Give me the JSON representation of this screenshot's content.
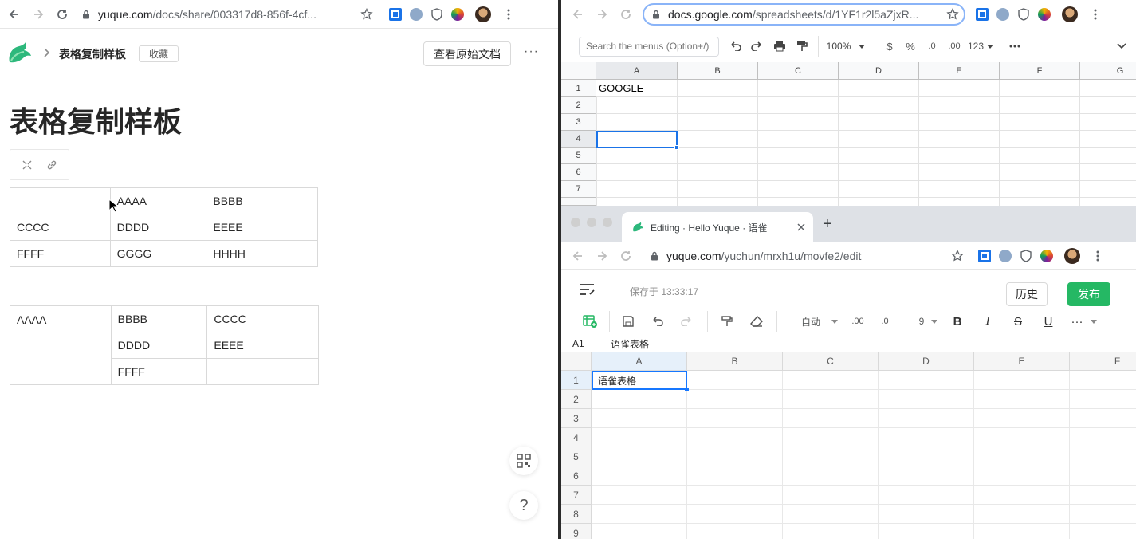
{
  "left_browser": {
    "url_host": "yuque.com",
    "url_path": "/docs/share/003317d8-856f-4cf..."
  },
  "doc": {
    "breadcrumb": "表格复制样板",
    "favorite_label": "收藏",
    "view_original_label": "查看原始文档",
    "more_label": "···",
    "title": "表格复制样板",
    "table1": [
      [
        "",
        "AAAA",
        "BBBB"
      ],
      [
        "CCCC",
        "DDDD",
        "EEEE"
      ],
      [
        "FFFF",
        "GGGG",
        "HHHH"
      ]
    ],
    "table2": {
      "merged": "AAAA",
      "rows": [
        [
          "BBBB",
          "CCCC"
        ],
        [
          "DDDD",
          "EEEE"
        ],
        [
          "FFFF",
          ""
        ]
      ]
    },
    "help_label": "?"
  },
  "gsheets": {
    "url_host": "docs.google.com",
    "url_path": "/spreadsheets/d/1YF1r2l5aZjxR...",
    "search_placeholder": "Search the menus (Option+/)",
    "zoom": "100%",
    "currency": "$",
    "percent": "%",
    "dec_less": ".0",
    "dec_more": ".00",
    "format_more": "123",
    "columns": [
      "A",
      "B",
      "C",
      "D",
      "E",
      "F",
      "G"
    ],
    "rows": [
      "1",
      "2",
      "3",
      "4",
      "5",
      "6",
      "7"
    ],
    "cell_a1": "GOOGLE"
  },
  "yuque": {
    "tab_title": "Editing · Hello Yuque · 语雀",
    "new_tab": "+",
    "url_host": "yuque.com",
    "url_path": "/yuchun/mrxh1u/movfe2/edit",
    "saved_text": "保存于 13:33:17",
    "history_label": "历史",
    "publish_label": "发布",
    "font_auto": "自动",
    "dec_more": ".00",
    "dec_less": ".0",
    "font_size": "9",
    "bold": "B",
    "italic": "I",
    "strike": "S",
    "underline": "U",
    "more": "···",
    "cell_ref": "A1",
    "formula_value": "语雀表格",
    "columns": [
      "A",
      "B",
      "C",
      "D",
      "E",
      "F"
    ],
    "rows": [
      "1",
      "2",
      "3",
      "4",
      "5",
      "6",
      "7",
      "8",
      "9"
    ],
    "cell_a1": "语雀表格"
  },
  "colors": {
    "publish_green": "#25b864",
    "selection_blue": "#1a73e8",
    "yuque_select": "#1677ff"
  }
}
